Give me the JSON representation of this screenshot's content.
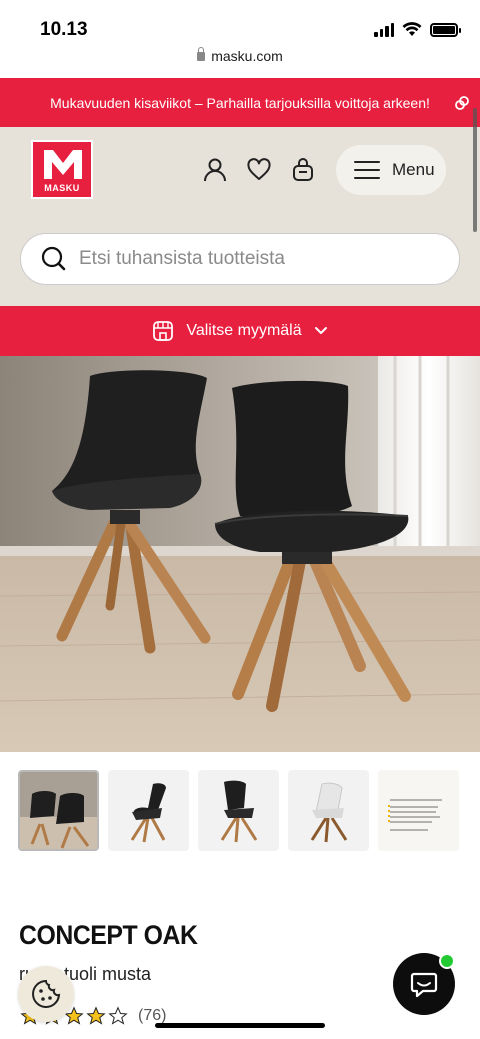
{
  "status_bar": {
    "time": "10.13"
  },
  "browser": {
    "url": "masku.com"
  },
  "promo": {
    "text": "Mukavuuden kisaviikot – Parhailla tarjouksilla voittoja arkeen!"
  },
  "header": {
    "logo_text": "MASKU",
    "menu_label": "Menu"
  },
  "search": {
    "placeholder": "Etsi tuhansista tuotteista"
  },
  "store": {
    "label": "Valitse myymälä"
  },
  "product": {
    "title": "CONCEPT OAK",
    "subtitle": "ruokatuoli musta",
    "rating_count": "(76)",
    "rating_stars": 4,
    "thumbnails": [
      "chairs-pair",
      "black-chair-side",
      "black-chair-front",
      "white-chair",
      "info-sheet"
    ]
  },
  "colors": {
    "brand_red": "#e8203f",
    "header_bg": "#e6e1d9",
    "chat_bg": "#0d0d0d",
    "online_green": "#22c933"
  }
}
